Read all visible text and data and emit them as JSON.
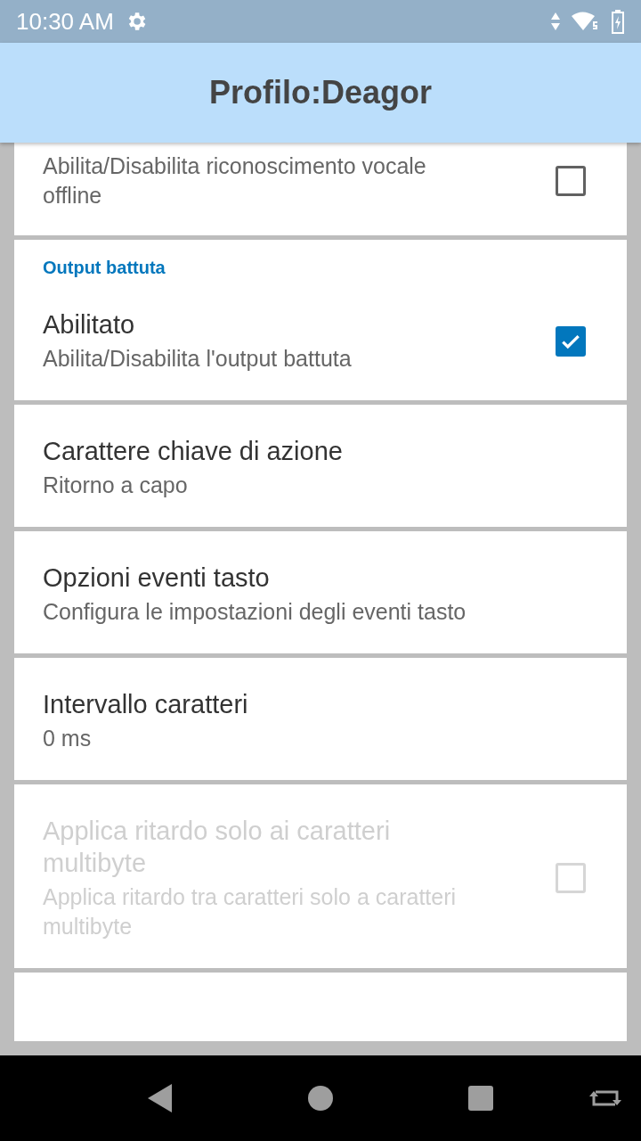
{
  "status_bar": {
    "time": "10:30 AM"
  },
  "header": {
    "title": "Profilo:Deagor"
  },
  "cards": [
    {
      "items": [
        {
          "kind": "checkbox",
          "summary": "Abilita/Disabilita riconoscimento vocale offline",
          "checked": false,
          "disabled": false
        }
      ]
    },
    {
      "section": "Output battuta",
      "items": [
        {
          "kind": "checkbox",
          "title": "Abilitato",
          "summary": "Abilita/Disabilita l'output battuta",
          "checked": true,
          "disabled": false
        }
      ]
    },
    {
      "items": [
        {
          "kind": "text",
          "title": "Carattere chiave di azione",
          "summary": "Ritorno a capo",
          "disabled": false
        }
      ]
    },
    {
      "items": [
        {
          "kind": "text",
          "title": "Opzioni eventi tasto",
          "summary": "Configura le impostazioni degli eventi tasto",
          "disabled": false
        }
      ]
    },
    {
      "items": [
        {
          "kind": "text",
          "title": "Intervallo caratteri",
          "summary": "0 ms",
          "disabled": false
        }
      ]
    },
    {
      "items": [
        {
          "kind": "checkbox",
          "title": "Applica ritardo solo ai caratteri multibyte",
          "summary": "Applica ritardo tra caratteri solo a caratteri multibyte",
          "checked": false,
          "disabled": true
        }
      ]
    }
  ]
}
